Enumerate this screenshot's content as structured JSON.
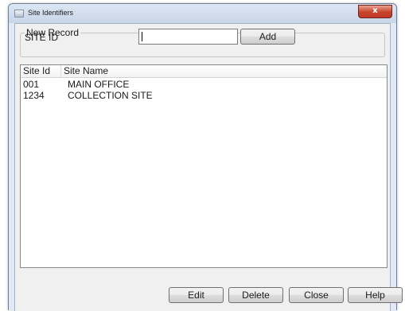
{
  "window": {
    "title": "Site Identifiers",
    "close_glyph": "x"
  },
  "new_record": {
    "legend": "New Record",
    "site_id_label": "SITE ID",
    "site_id_value": "",
    "add_label": "Add"
  },
  "list": {
    "columns": [
      "Site Id",
      "Site Name"
    ],
    "rows": [
      {
        "id": "001",
        "name": "MAIN OFFICE"
      },
      {
        "id": "1234",
        "name": "COLLECTION SITE"
      }
    ]
  },
  "buttons": {
    "edit": "Edit",
    "delete": "Delete",
    "close": "Close",
    "help": "Help"
  }
}
